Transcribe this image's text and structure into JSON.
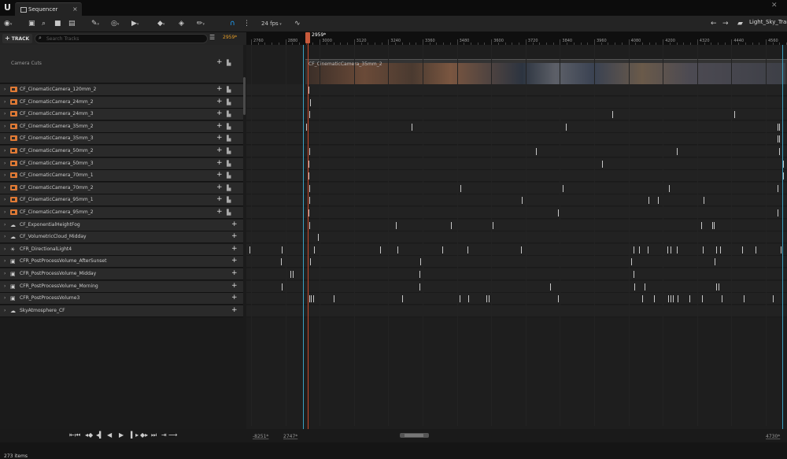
{
  "window": {
    "tab_label": "Sequencer",
    "close_label": "×"
  },
  "toolbar": {
    "fps_label": "24 fps",
    "path_label": "Light_Sky_Tran"
  },
  "left": {
    "add_track_label": "TRACK",
    "search_placeholder": "Search Tracks",
    "current_frame": "2959*",
    "camera_cuts_label": "Camera Cuts",
    "items_count": "273 items",
    "tracks": [
      {
        "label": "CF_CinematicCamera_120mm_2",
        "icon": "camera-icon"
      },
      {
        "label": "CF_CinematicCamera_24mm_2",
        "icon": "camera-icon"
      },
      {
        "label": "CF_CinematicCamera_24mm_3",
        "icon": "camera-icon"
      },
      {
        "label": "CF_CinematicCamera_35mm_2",
        "icon": "camera-icon"
      },
      {
        "label": "CF_CinematicCamera_35mm_3",
        "icon": "camera-icon"
      },
      {
        "label": "CF_CinematicCamera_50mm_2",
        "icon": "camera-icon"
      },
      {
        "label": "CF_CinematicCamera_50mm_3",
        "icon": "camera-icon"
      },
      {
        "label": "CF_CinematicCamera_70mm_1",
        "icon": "camera-icon"
      },
      {
        "label": "CF_CinematicCamera_70mm_2",
        "icon": "camera-icon"
      },
      {
        "label": "CF_CinematicCamera_95mm_1",
        "icon": "camera-icon"
      },
      {
        "label": "CF_CinematicCamera_95mm_2",
        "icon": "camera-icon"
      },
      {
        "label": "CF_ExponentialHeightFog",
        "icon": "fog-icon"
      },
      {
        "label": "CF_VolumetricCloud_Midday",
        "icon": "cloud-icon"
      },
      {
        "label": "CFR_DirectionalLight4",
        "icon": "sun-icon"
      },
      {
        "label": "CFR_PostProcessVolume_AfterSunset",
        "icon": "volume-icon"
      },
      {
        "label": "CFR_PostProcessVolume_Midday",
        "icon": "volume-icon"
      },
      {
        "label": "CFR_PostProcessVolume_Morning",
        "icon": "volume-icon"
      },
      {
        "label": "CFR_PostProcessVolume3",
        "icon": "volume-icon"
      },
      {
        "label": "SkyAtmosphere_CF",
        "icon": "sky-icon"
      }
    ]
  },
  "timeline": {
    "ruler_labels": [
      "2760",
      "2880",
      "3000",
      "3120",
      "3240",
      "3360",
      "3480",
      "3600",
      "3720",
      "3840",
      "3960",
      "4080",
      "4200",
      "4320",
      "4440",
      "4560"
    ],
    "playhead_label": "2959*",
    "shot_label": "CF_CinematicCamera_35mm_2",
    "view_start": "-8251*",
    "selection_start": "2747*",
    "view_end": "4730*"
  }
}
